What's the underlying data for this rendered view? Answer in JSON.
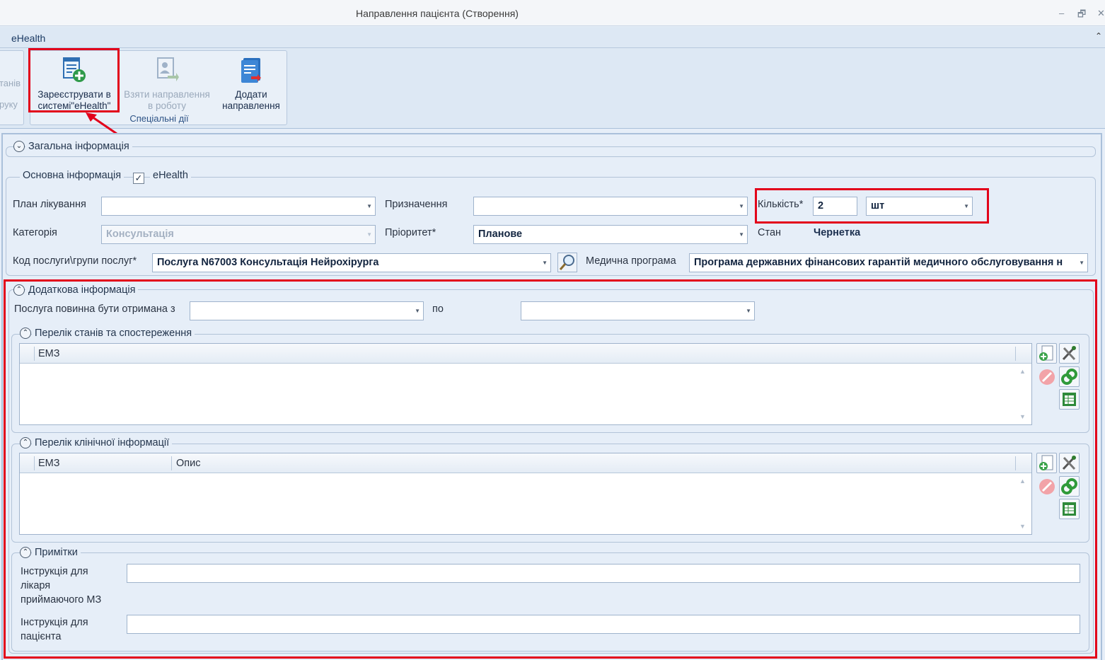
{
  "window": {
    "title": "Направлення пацієнта (Створення)",
    "minimize": "–",
    "restore": "🗗",
    "close": "✕"
  },
  "ribbon": {
    "tab": "eHealth",
    "prev_group_labels": [
      "танів",
      "руку"
    ],
    "group_caption": "Спеціальні дії",
    "buttons": {
      "register_line1": "Зареєструвати в",
      "register_line2": "системі\"eHealth\"",
      "take_line1": "Взяти направлення",
      "take_line2": "в роботу",
      "add_line1": "Додати",
      "add_line2": "направлення"
    }
  },
  "general": {
    "legend": "Загальна інформація"
  },
  "main_info": {
    "legend": "Основна інформація",
    "ehealth_label": "eHealth",
    "ehealth_checked": "✓",
    "plan_label": "План лікування",
    "plan_value": "",
    "assign_label": "Призначення",
    "assign_value": "",
    "qty_label": "Кількість*",
    "qty_value": "2",
    "unit_value": "шт",
    "category_label": "Категорія",
    "category_value": "Консультація",
    "priority_label": "Пріоритет*",
    "priority_value": "Планове",
    "state_label": "Стан",
    "state_value": "Чернетка",
    "service_label": "Код послуги\\групи послуг*",
    "service_value": "Послуга N67003 Консультація Нейрохірурга",
    "program_label": "Медична програма",
    "program_value": "Програма державних фінансових гарантій медичного обслуговування н"
  },
  "extra": {
    "legend": "Додаткова інформація",
    "period_label": "Послуга повинна бути отримана з",
    "period_to_label": "по",
    "period_from": "",
    "period_to": ""
  },
  "conditions": {
    "legend": "Перелік станів та спостереження",
    "columns": [
      "ЕМЗ"
    ]
  },
  "clinical": {
    "legend": "Перелік клінічної інформації",
    "columns": [
      "ЕМЗ",
      "Опис"
    ]
  },
  "notes": {
    "legend": "Примітки",
    "doctor_label_1": "Інструкція для",
    "doctor_label_2": "лікаря",
    "doctor_label_3": "приймаючого МЗ",
    "patient_label_1": "Інструкція для",
    "patient_label_2": "пацієнта"
  },
  "colors": {
    "highlight": "#e2001a",
    "ribbon_bg": "#dde8f4",
    "form_bg": "#e6eef8"
  }
}
